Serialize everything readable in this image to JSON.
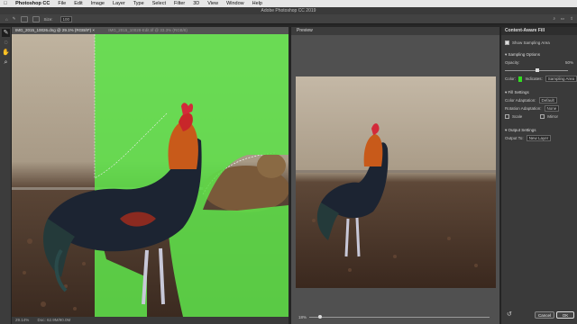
{
  "menubar": {
    "apple": "",
    "app": "Photoshop CC",
    "items": [
      "File",
      "Edit",
      "Image",
      "Layer",
      "Type",
      "Select",
      "Filter",
      "3D",
      "View",
      "Window",
      "Help"
    ]
  },
  "window_title": "Adobe Photoshop CC 2019",
  "options": {
    "size_label": "Size:",
    "size_value": "100"
  },
  "doc": {
    "tab1": "IMG_2015_10026.dng @ 29.1% (RGB/8*) ×",
    "tab2": "IMG_2015_10028-Edit.tif @ 33.3% (RGB/8)"
  },
  "status": {
    "zoom": "29.14%",
    "doc": "Doc: 62.9M/90.0M"
  },
  "preview": {
    "title": "Preview",
    "zoom": "18%"
  },
  "panel": {
    "title": "Content-Aware Fill",
    "show_sampling": "Show Sampling Area",
    "sampling_options": "Sampling Options",
    "opacity_label": "Opacity:",
    "opacity_value": "50%",
    "color_label": "Color:",
    "indicates_label": "Indicates:",
    "indicates_value": "Sampling Area",
    "fill_settings": "Fill Settings",
    "color_adaptation_label": "Color Adaptation:",
    "color_adaptation_value": "Default",
    "rotation_label": "Rotation Adaptation:",
    "rotation_value": "None",
    "scale_label": "Scale",
    "mirror_label": "Mirror",
    "output_settings": "Output Settings",
    "output_to_label": "Output To:",
    "output_to_value": "New Layer",
    "cancel": "Cancel",
    "ok": "OK"
  },
  "colors": {
    "sampling_overlay": "#5fe04a"
  }
}
